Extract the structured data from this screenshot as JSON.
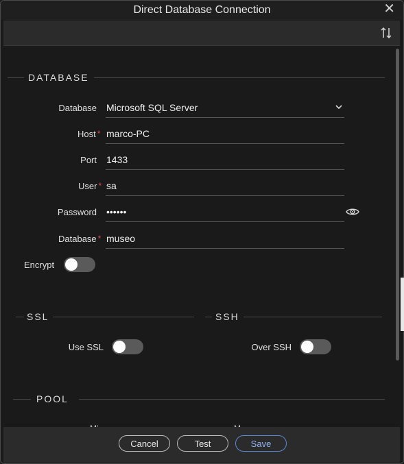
{
  "window": {
    "title": "Direct Database Connection",
    "close_glyph": "✕"
  },
  "sections": {
    "database": "DATABASE",
    "ssl": "SSL",
    "ssh": "SSH",
    "pool": "POOL"
  },
  "fields": {
    "database_type": {
      "label": "Database",
      "value": "Microsoft SQL Server"
    },
    "host": {
      "label": "Host",
      "value": "marco-PC",
      "required": "*"
    },
    "port": {
      "label": "Port",
      "value": "1433"
    },
    "user": {
      "label": "User",
      "value": "sa",
      "required": "*"
    },
    "password": {
      "label": "Password",
      "value": "••••••"
    },
    "database_name": {
      "label": "Database",
      "value": "museo",
      "required": "*"
    }
  },
  "toggles": {
    "encrypt": {
      "label": "Encrypt",
      "on": false
    },
    "use_ssl": {
      "label": "Use SSL",
      "on": false
    },
    "over_ssh": {
      "label": "Over SSH",
      "on": false
    }
  },
  "pool": {
    "cut_left": "Mi",
    "cut_right": "M"
  },
  "buttons": {
    "cancel": "Cancel",
    "test": "Test",
    "save": "Save"
  },
  "colors": {
    "accent": "#5a86d6",
    "required": "#e04a4a",
    "toggle_off": "#5a5a5a"
  },
  "icons": {
    "toolbar": "sort-arrows-icon",
    "dropdown": "chevron-down-icon",
    "password": "eye-icon",
    "close": "close-icon"
  }
}
